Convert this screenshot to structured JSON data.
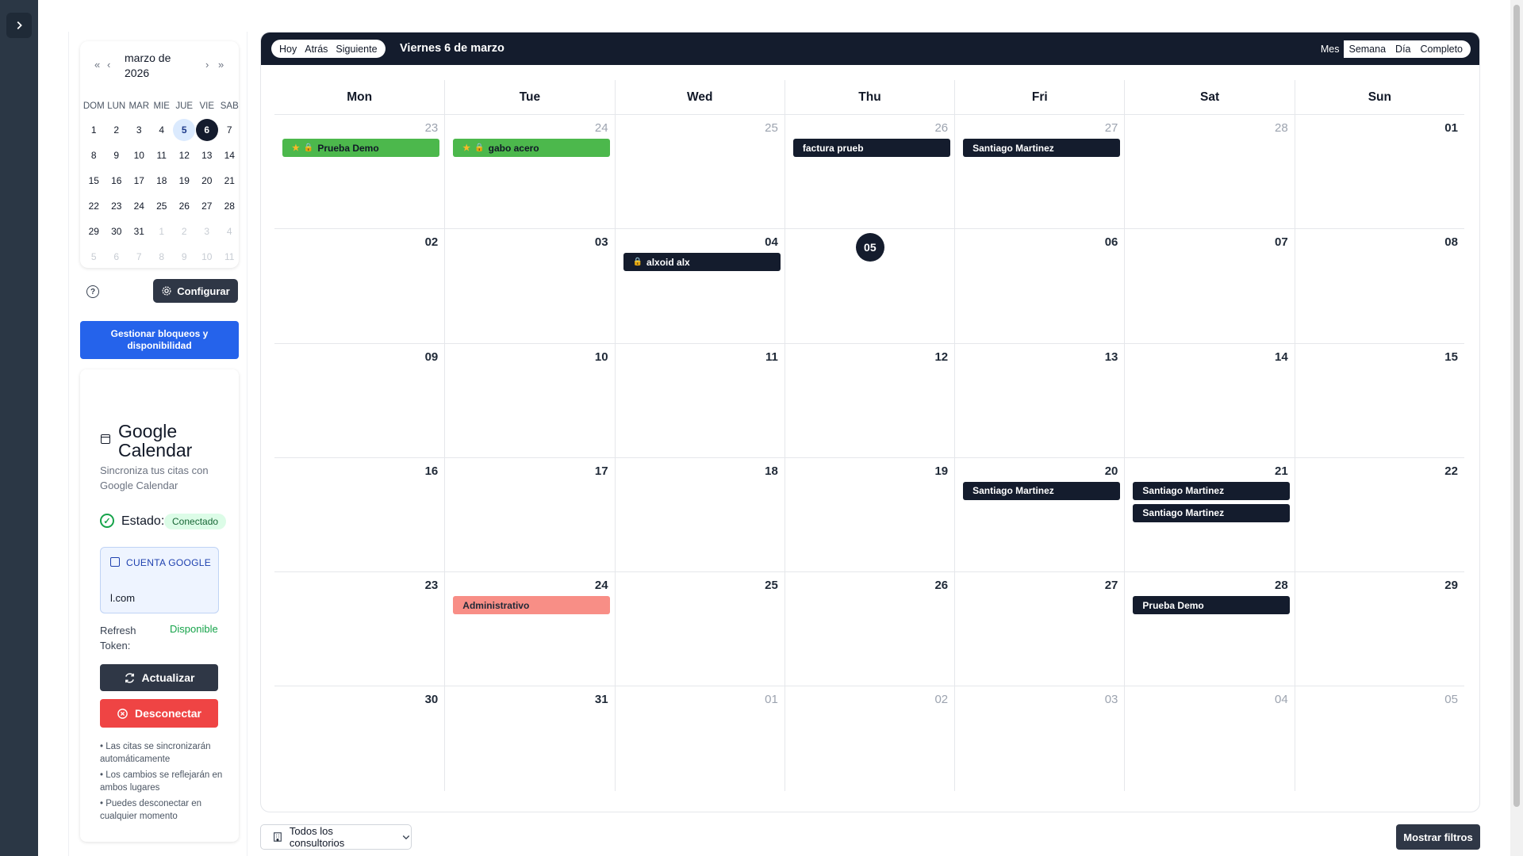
{
  "mini_calendar": {
    "title": "marzo de 2026",
    "nav": {
      "prev_year": "«",
      "prev_month": "‹",
      "next_month": "›",
      "next_year": "»"
    },
    "dows": [
      "DOM",
      "LUN",
      "MAR",
      "MIÉ",
      "JUE",
      "VIE",
      "SÁB"
    ],
    "days": [
      {
        "n": "1"
      },
      {
        "n": "2"
      },
      {
        "n": "3"
      },
      {
        "n": "4"
      },
      {
        "n": "5",
        "state": "today"
      },
      {
        "n": "6",
        "state": "selected"
      },
      {
        "n": "7"
      },
      {
        "n": "8"
      },
      {
        "n": "9"
      },
      {
        "n": "10"
      },
      {
        "n": "11"
      },
      {
        "n": "12"
      },
      {
        "n": "13"
      },
      {
        "n": "14"
      },
      {
        "n": "15"
      },
      {
        "n": "16"
      },
      {
        "n": "17"
      },
      {
        "n": "18"
      },
      {
        "n": "19"
      },
      {
        "n": "20"
      },
      {
        "n": "21"
      },
      {
        "n": "22"
      },
      {
        "n": "23"
      },
      {
        "n": "24"
      },
      {
        "n": "25"
      },
      {
        "n": "26"
      },
      {
        "n": "27"
      },
      {
        "n": "28"
      },
      {
        "n": "29"
      },
      {
        "n": "30"
      },
      {
        "n": "31"
      },
      {
        "n": "1",
        "state": "muted"
      },
      {
        "n": "2",
        "state": "muted"
      },
      {
        "n": "3",
        "state": "muted"
      },
      {
        "n": "4",
        "state": "muted"
      },
      {
        "n": "5",
        "state": "muted"
      },
      {
        "n": "6",
        "state": "muted"
      },
      {
        "n": "7",
        "state": "muted"
      },
      {
        "n": "8",
        "state": "muted"
      },
      {
        "n": "9",
        "state": "muted"
      },
      {
        "n": "10",
        "state": "muted"
      },
      {
        "n": "11",
        "state": "muted"
      }
    ]
  },
  "sidebar": {
    "help": "?",
    "configure_label": "Configurar",
    "manage_label": "Gestionar bloqueos y disponibilidad"
  },
  "google": {
    "title": "Google Calendar",
    "subtitle": "Sincroniza tus citas con Google Calendar",
    "status_label": "Estado:",
    "status_value": "Conectado",
    "account_label": "CUENTA GOOGLE",
    "account_email": "l.com",
    "refresh_label": "Refresh Token:",
    "refresh_value": "Disponible",
    "update_label": "Actualizar",
    "disconnect_label": "Desconectar",
    "notes": [
      "• Las citas se sincronizarán automáticamente",
      "• Los cambios se reflejarán en ambos lugares",
      "• Puedes desconectar en cualquier momento"
    ]
  },
  "toolbar": {
    "today": "Hoy",
    "back": "Atrás",
    "next": "Siguiente",
    "title": "Viernes 6 de marzo",
    "views": [
      "Mes",
      "Semana",
      "Día",
      "Completo"
    ],
    "active_view": "Mes"
  },
  "calendar": {
    "weekdays": [
      "Mon",
      "Tue",
      "Wed",
      "Thu",
      "Fri",
      "Sat",
      "Sun"
    ],
    "weeks": [
      [
        {
          "n": "23",
          "muted": true,
          "events": [
            {
              "title": "Prueba Demo",
              "style": "green",
              "star": true,
              "lock": true
            }
          ]
        },
        {
          "n": "24",
          "muted": true,
          "events": [
            {
              "title": "gabo acero",
              "style": "green",
              "star": true,
              "lock": true
            }
          ]
        },
        {
          "n": "25",
          "muted": true,
          "events": []
        },
        {
          "n": "26",
          "muted": true,
          "events": [
            {
              "title": "factura prueb",
              "style": "dark"
            }
          ]
        },
        {
          "n": "27",
          "muted": true,
          "events": [
            {
              "title": "Santiago Martinez",
              "style": "dark"
            }
          ]
        },
        {
          "n": "28",
          "muted": true,
          "events": []
        },
        {
          "n": "01",
          "events": []
        }
      ],
      [
        {
          "n": "02",
          "events": []
        },
        {
          "n": "03",
          "events": []
        },
        {
          "n": "04",
          "events": [
            {
              "title": "alxoid alx",
              "style": "dark",
              "lock": true
            }
          ]
        },
        {
          "n": "05",
          "today": true,
          "events": []
        },
        {
          "n": "06",
          "events": []
        },
        {
          "n": "07",
          "events": []
        },
        {
          "n": "08",
          "events": []
        }
      ],
      [
        {
          "n": "09",
          "events": []
        },
        {
          "n": "10",
          "events": []
        },
        {
          "n": "11",
          "events": []
        },
        {
          "n": "12",
          "events": []
        },
        {
          "n": "13",
          "events": []
        },
        {
          "n": "14",
          "events": []
        },
        {
          "n": "15",
          "events": []
        }
      ],
      [
        {
          "n": "16",
          "events": []
        },
        {
          "n": "17",
          "events": []
        },
        {
          "n": "18",
          "events": []
        },
        {
          "n": "19",
          "events": []
        },
        {
          "n": "20",
          "events": [
            {
              "title": "Santiago Martinez",
              "style": "dark"
            }
          ]
        },
        {
          "n": "21",
          "events": [
            {
              "title": "Santiago Martinez",
              "style": "dark"
            },
            {
              "title": "Santiago Martinez",
              "style": "dark"
            }
          ]
        },
        {
          "n": "22",
          "events": []
        }
      ],
      [
        {
          "n": "23",
          "events": []
        },
        {
          "n": "24",
          "events": [
            {
              "title": "Administrativo",
              "style": "salmon"
            }
          ]
        },
        {
          "n": "25",
          "events": []
        },
        {
          "n": "26",
          "events": []
        },
        {
          "n": "27",
          "events": []
        },
        {
          "n": "28",
          "events": [
            {
              "title": "Prueba Demo",
              "style": "dark"
            }
          ]
        },
        {
          "n": "29",
          "events": []
        }
      ],
      [
        {
          "n": "30",
          "events": []
        },
        {
          "n": "31",
          "events": []
        },
        {
          "n": "01",
          "muted": true,
          "events": []
        },
        {
          "n": "02",
          "muted": true,
          "events": []
        },
        {
          "n": "03",
          "muted": true,
          "events": []
        },
        {
          "n": "04",
          "muted": true,
          "events": []
        },
        {
          "n": "05",
          "muted": true,
          "events": []
        }
      ]
    ]
  },
  "footer": {
    "offices_label": "Todos los consultorios",
    "filters_label": "Mostrar filtros"
  },
  "colors": {
    "navy": "#141c2d",
    "event_green": "#4cb84c",
    "event_salmon": "#f88e86",
    "primary_blue": "#2563eb",
    "danger": "#ef4444",
    "success": "#16a34a"
  }
}
